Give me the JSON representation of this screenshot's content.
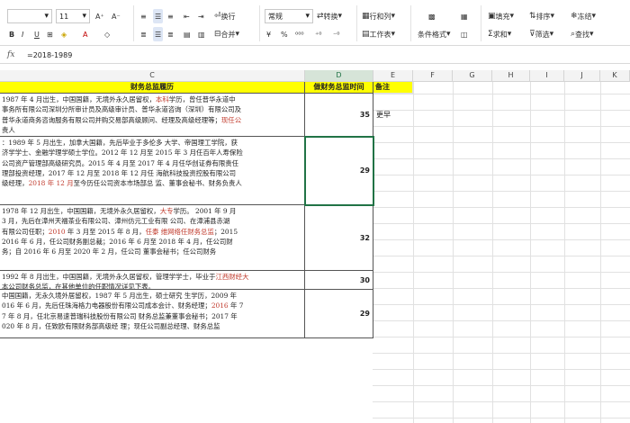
{
  "ribbon": {
    "font_size": "11",
    "font_grow": "A⁺",
    "font_shrink": "A⁻",
    "wrap_label": "换行",
    "merge_label": "合并",
    "number_format": "常规",
    "convert_label": "转换",
    "rows_cols_label": "行和列",
    "worksheet_label": "工作表",
    "cond_format_label": "条件格式",
    "fill_label": "填充",
    "sort_label": "排序",
    "freeze_label": "冻结",
    "sum_label": "求和",
    "filter_label": "筛选",
    "find_label": "查找"
  },
  "formula_bar": {
    "fx": "fx",
    "value": "=2018-1989"
  },
  "columns": [
    "C",
    "D",
    "E",
    "F",
    "G",
    "H",
    "I",
    "J",
    "K"
  ],
  "header_row": {
    "c": "财务总监履历",
    "d": "做财务总监时间",
    "e": "备注"
  },
  "rows": [
    {
      "lines": [
        {
          "parts": [
            {
              "t": "1987 年 4 月出生，中国国籍，无境外永久居留权，"
            },
            {
              "t": "本科",
              "red": true
            },
            {
              "t": "学历，曾任普华永道中"
            }
          ]
        },
        {
          "parts": [
            {
              "t": "事务所有限公司深圳分所审计员及高级审计员、普华永道咨询（深圳）有限公司及"
            }
          ]
        },
        {
          "parts": [
            {
              "t": "普华永道商务咨询服务有限公司并购交易部高级顾问、经理及高级经理等；"
            },
            {
              "t": "现任公",
              "red": true
            }
          ]
        },
        {
          "parts": [
            {
              "t": "责人"
            }
          ]
        }
      ],
      "value": "35",
      "note": "更早"
    },
    {
      "lines": [
        {
          "parts": [
            {
              "t": "：1989 年 5 月出生，加拿大国籍，先后毕业于多伦多 大学、帝国理工学院，获"
            }
          ]
        },
        {
          "parts": [
            {
              "t": "济学学士、金融学理学硕士学位。2012 年 12 月至 2015 年 3 月任百年人寿保险"
            }
          ]
        },
        {
          "parts": [
            {
              "t": "公司资产管理部高级研究员。2015 年 4 月至 2017 年 4 月任华创证券有限责任"
            }
          ]
        },
        {
          "parts": [
            {
              "t": "理部投资经理，2017 年 12 月至 2018 年 12 月任 海航科技投资控股有限公司"
            }
          ]
        },
        {
          "parts": [
            {
              "t": "级经理，"
            },
            {
              "t": "2018 年 12 月",
              "red": true
            },
            {
              "t": "至今历任公司资本市场部总 监、董事会秘书、财务负责人"
            }
          ]
        }
      ],
      "value": "29",
      "note": ""
    },
    {
      "lines": [
        {
          "parts": [
            {
              "t": "1978 年 12 月出生，中国国籍，无境外永久居留权，"
            },
            {
              "t": "大专",
              "red": true
            },
            {
              "t": "学历。 2001 年 9 月"
            }
          ]
        },
        {
          "parts": [
            {
              "t": "3 月，先后在漳州天福茶业有限公司、漳州仿元工业有限 公司、在漳浦县赤湖"
            }
          ]
        },
        {
          "parts": [
            {
              "t": "有限公司任职；"
            },
            {
              "t": "2010",
              "red": true
            },
            {
              "t": " 年 3 月至 2015 年 8 月，"
            },
            {
              "t": "任泰 维网络任财务总监",
              "red": true
            },
            {
              "t": "；2015"
            }
          ]
        },
        {
          "parts": [
            {
              "t": "2016 年 6 月，任公司财务副总裁；2016 年 6 月至 2018 年 4 月，任公司财"
            }
          ]
        },
        {
          "parts": [
            {
              "t": "务；自 2016 年 6 月至 2020 年 2 月，任公司 董事会秘书；任公司财务"
            }
          ]
        }
      ],
      "value": "32",
      "note": ""
    },
    {
      "lines": [
        {
          "parts": [
            {
              "t": "1992 年 8 月出生，中国国籍，无境外永久居留权，管理学学士，毕业于"
            },
            {
              "t": "江西财经大",
              "red": true
            }
          ]
        },
        {
          "parts": [
            {
              "t": "本公司财务总监，在其他单位的任职情况详见下表。"
            }
          ]
        }
      ],
      "value": "30",
      "note": ""
    },
    {
      "lines": [
        {
          "parts": [
            {
              "t": "中国国籍，无永久境外居留权，1987 年 5 月出生，硕士研究 生学历，2009 年"
            }
          ]
        },
        {
          "parts": [
            {
              "t": "016 年 6 月，先后任珠海格力电器股份有限公司成本会计、财务经理；"
            },
            {
              "t": "2016",
              "red": true
            },
            {
              "t": " 年 7"
            }
          ]
        },
        {
          "parts": [
            {
              "t": "7 年 8 月，任北京易速普瑞科技股份有限公司 财务总监兼董事会秘书；2017 年"
            }
          ]
        },
        {
          "parts": [
            {
              "t": "020 年 8 月，任致欧有限财务部高级经 理；现任公司副总经理、财务总监"
            }
          ]
        }
      ],
      "value": "29",
      "note": ""
    }
  ]
}
